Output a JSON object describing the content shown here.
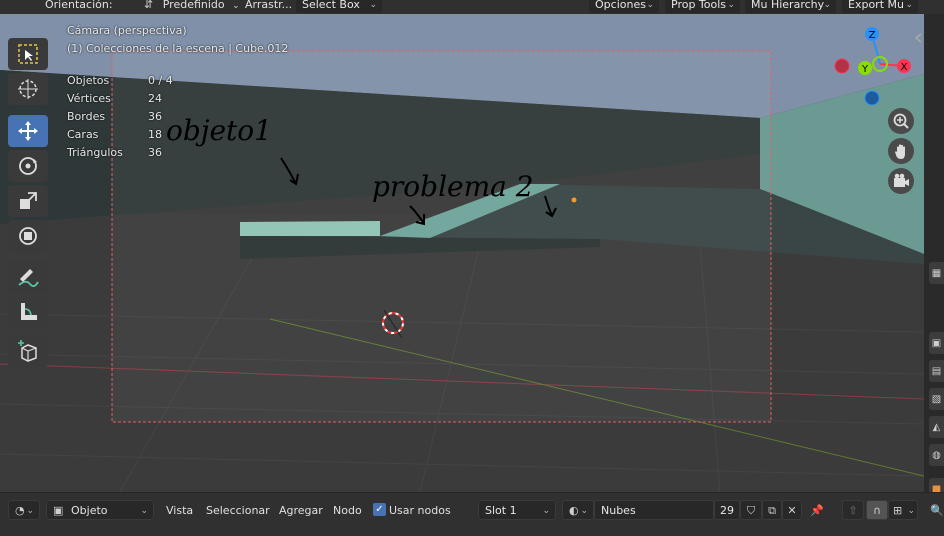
{
  "header": {
    "orientation_label": "Orientación:",
    "orientation_value": "Predefinido",
    "drag_label": "Arrastr...",
    "select_mode": "Select Box",
    "menus": [
      "Opciones",
      "Prop Tools",
      "Mu Hierarchy",
      "Export Mu"
    ]
  },
  "viewport": {
    "view_name": "Cámara (perspectiva)",
    "collection_path": "(1) Colecciones de la escena | Cube.012",
    "stats": [
      {
        "label": "Objetos",
        "value": "0 / 4"
      },
      {
        "label": "Vértices",
        "value": "24"
      },
      {
        "label": "Bordes",
        "value": "36"
      },
      {
        "label": "Caras",
        "value": "18"
      },
      {
        "label": "Triángulos",
        "value": "36"
      }
    ],
    "annotations": [
      "objeto1",
      "problema 2"
    ],
    "gizmo_axes": {
      "z": "Z",
      "y": "Y",
      "x": "X"
    }
  },
  "tools": [
    {
      "name": "select-box-tool",
      "active": false
    },
    {
      "name": "cursor-tool",
      "active": false
    },
    {
      "name": "move-tool",
      "active": true
    },
    {
      "name": "rotate-tool",
      "active": false
    },
    {
      "name": "scale-tool",
      "active": false
    },
    {
      "name": "transform-tool",
      "active": false
    },
    {
      "name": "annotate-tool",
      "active": false
    },
    {
      "name": "measure-tool",
      "active": false
    },
    {
      "name": "add-cube-tool",
      "active": false
    }
  ],
  "footer": {
    "mode": "Objeto",
    "menu_view": "Vista",
    "menu_select": "Seleccionar",
    "menu_add": "Agregar",
    "menu_node": "Nodo",
    "use_nodes_label": "Usar nodos",
    "use_nodes_checked": true,
    "slot": "Slot 1",
    "material_name": "Nubes",
    "users_count": "29"
  },
  "colors": {
    "accent": "#4772b3",
    "axis_x": "#ff3352",
    "axis_y": "#8bdc00",
    "axis_z": "#2890ff"
  }
}
